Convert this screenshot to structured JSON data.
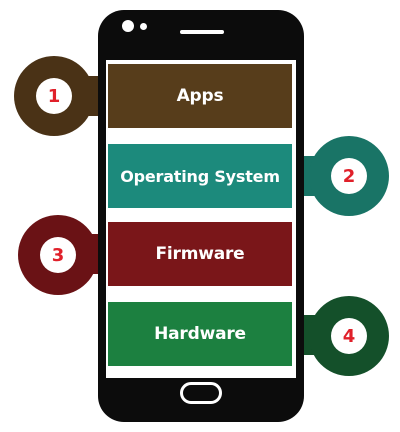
{
  "layers": [
    {
      "label": "Apps",
      "number": "1",
      "color": "#573d1b",
      "ring": "#4a3216",
      "side": "left"
    },
    {
      "label": "Operating System",
      "number": "2",
      "color": "#1c8a7c",
      "ring": "#197466",
      "side": "right"
    },
    {
      "label": "Firmware",
      "number": "3",
      "color": "#7a1619",
      "ring": "#6a1215",
      "side": "left"
    },
    {
      "label": "Hardware",
      "number": "4",
      "color": "#1c8040",
      "ring": "#14502a",
      "side": "right"
    }
  ]
}
